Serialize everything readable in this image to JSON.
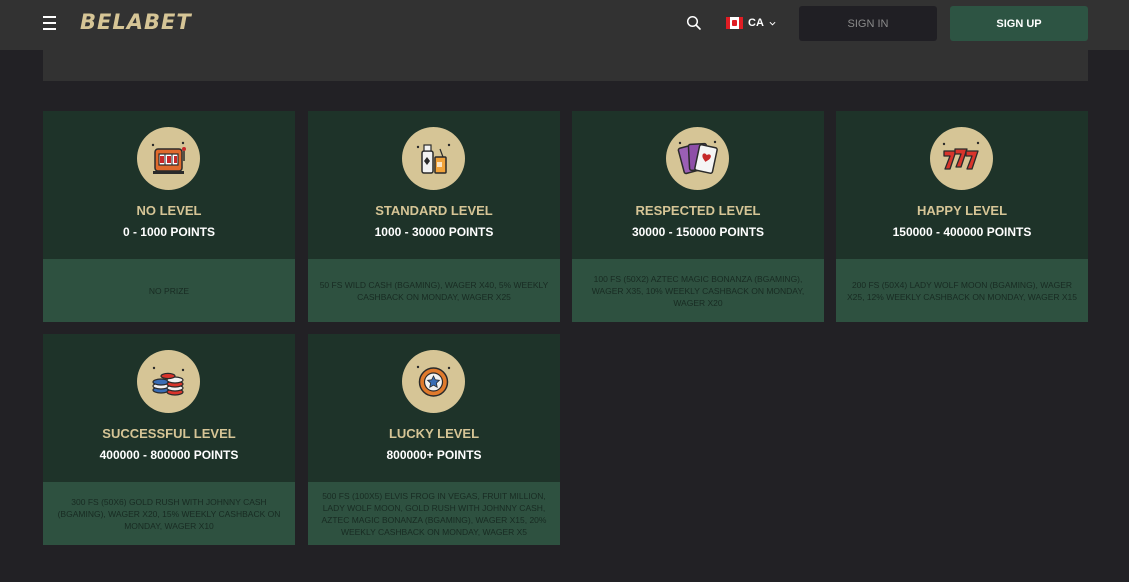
{
  "header": {
    "logo": "BELABET",
    "lang_code": "CA",
    "signin_label": "SIGN IN",
    "signup_label": "SIGN UP"
  },
  "levels": [
    {
      "name": "NO LEVEL",
      "points": "0 - 1000 POINTS",
      "prize": "NO PRIZE",
      "icon": "slot-machine-icon"
    },
    {
      "name": "STANDARD LEVEL",
      "points": "1000 - 30000 POINTS",
      "prize": "50 FS WILD CASH (BGAMING), WAGER X40, 5% WEEKLY CASHBACK ON MONDAY, WAGER X25",
      "icon": "drinks-icon"
    },
    {
      "name": "RESPECTED LEVEL",
      "points": "30000 - 150000 POINTS",
      "prize": "100 FS (50X2) AZTEC MAGIC BONANZA (BGAMING), WAGER X35, 10% WEEKLY CASHBACK ON MONDAY, WAGER X20",
      "icon": "playing-cards-icon"
    },
    {
      "name": "HAPPY LEVEL",
      "points": "150000 - 400000 POINTS",
      "prize": "200 FS (50X4) LADY WOLF MOON (BGAMING), WAGER X25, 12% WEEKLY CASHBACK ON MONDAY, WAGER X15",
      "icon": "triple-seven-icon"
    },
    {
      "name": "SUCCESSFUL LEVEL",
      "points": "400000 - 800000 POINTS",
      "prize": "300 FS (50X6) GOLD RUSH WITH JOHNNY CASH (BGAMING), WAGER X20, 15% WEEKLY CASHBACK ON MONDAY, WAGER X10",
      "icon": "chip-stacks-icon"
    },
    {
      "name": "LUCKY LEVEL",
      "points": "800000+ POINTS",
      "prize": "500 FS (100X5) ELVIS FROG IN VEGAS, FRUIT MILLION, LADY WOLF MOON, GOLD RUSH WITH JOHNNY CASH, AZTEC MAGIC BONANZA (BGAMING), WAGER X15, 20% WEEKLY CASHBACK ON MONDAY, WAGER X5",
      "icon": "poker-chip-icon"
    }
  ],
  "colors": {
    "background": "#222125",
    "header": "#323232",
    "gold": "#d6c596",
    "card_top": "#1e3329",
    "card_bottom": "#2e5140",
    "signup": "#2d5443"
  }
}
